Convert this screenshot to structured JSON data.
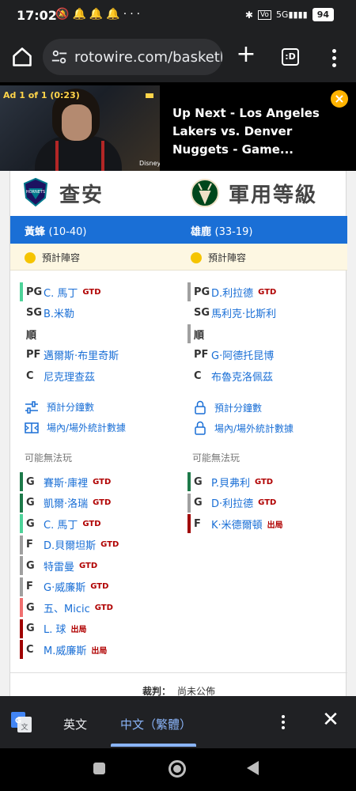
{
  "status_bar": {
    "time": "17:02",
    "battery": "94",
    "icons": [
      "mute-icon",
      "bell-icon",
      "bell-icon",
      "bell-icon",
      "more-dots-icon",
      "bluetooth-icon",
      "volte-icon",
      "signal-5g-icon",
      "battery-icon"
    ]
  },
  "browser": {
    "url": "rotowire.com/basketb",
    "tabs_label": ":D"
  },
  "video": {
    "counter": "Ad 1 of 1 (0:23)",
    "logo": "Disney+",
    "up_next": "Up Next - Los Angeles Lakers vs. Denver Nuggets - Game..."
  },
  "teams": {
    "left": {
      "name": "查安",
      "nickname": "黃蜂",
      "record": "(10-40)"
    },
    "right": {
      "name": "軍用等級",
      "nickname": "雄鹿",
      "record": "(33-19)"
    }
  },
  "projected_label": "預計陣容",
  "left_lineup": [
    {
      "pos": "PG",
      "name": "C. 馬丁",
      "tag": "GTD"
    },
    {
      "pos": "SG",
      "name": "B.米勒",
      "tag": ""
    },
    {
      "pos": "順",
      "name": "",
      "tag": ""
    },
    {
      "pos": "PF",
      "name": "邁爾斯·布里奇斯",
      "tag": ""
    },
    {
      "pos": "C",
      "name": "尼克理查茲",
      "tag": ""
    }
  ],
  "right_lineup": [
    {
      "pos": "PG",
      "name": "D.利拉德",
      "tag": "GTD"
    },
    {
      "pos": "SG",
      "name": "馬利克·比斯利",
      "tag": ""
    },
    {
      "pos": "順",
      "name": "",
      "tag": ""
    },
    {
      "pos": "PF",
      "name": "G·阿德托昆博",
      "tag": ""
    },
    {
      "pos": "C",
      "name": "布魯克洛佩茲",
      "tag": ""
    }
  ],
  "links": {
    "minutes": "預計分鐘數",
    "splits": "場內/場外統計數據"
  },
  "maybe_label": "可能無法玩",
  "left_injuries": [
    {
      "pos": "G",
      "name": "賽斯·庫裡",
      "tag": "GTD"
    },
    {
      "pos": "G",
      "name": "凱爾·洛瑞",
      "tag": "GTD"
    },
    {
      "pos": "G",
      "name": "C. 馬丁",
      "tag": "GTD"
    },
    {
      "pos": "F",
      "name": "D.貝爾坦斯",
      "tag": "GTD"
    },
    {
      "pos": "G",
      "name": "特雷曼",
      "tag": "GTD"
    },
    {
      "pos": "F",
      "name": "G·威廉斯",
      "tag": "GTD"
    },
    {
      "pos": "G",
      "name": "五、Micic",
      "tag": "GTD"
    },
    {
      "pos": "G",
      "name": "L. 球",
      "tag": "出局"
    },
    {
      "pos": "C",
      "name": "M.威廉斯",
      "tag": "出局"
    }
  ],
  "right_injuries": [
    {
      "pos": "G",
      "name": "P.貝弗利",
      "tag": "GTD"
    },
    {
      "pos": "G",
      "name": "D·利拉德",
      "tag": "GTD"
    },
    {
      "pos": "F",
      "name": "K·米德爾頓",
      "tag": "出局"
    }
  ],
  "referee": {
    "label": "裁判：",
    "value": "尚未公佈"
  },
  "translate": {
    "source": "英文",
    "target": "中文（繁體）"
  },
  "colors": {
    "team_bar": "#1a6fd6",
    "link": "#1a6fd6",
    "gtd": "#b00000",
    "projected_bg": "#fdf7e2",
    "bar_dark_green": "#1e7a4a",
    "bar_light_green": "#4fd39a",
    "bar_grey": "#a0a0a0",
    "bar_pink": "#f07070",
    "bar_dark_red": "#a00000"
  }
}
